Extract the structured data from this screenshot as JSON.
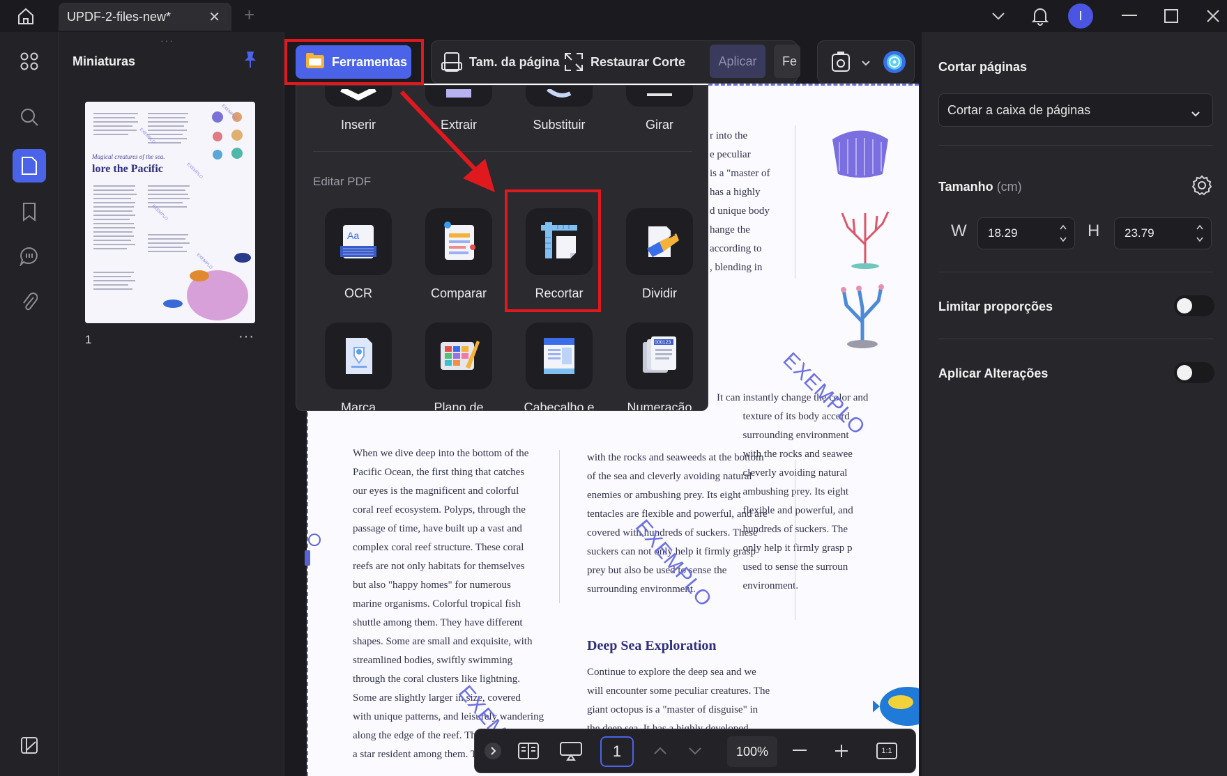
{
  "titlebar": {
    "tab_title": "UPDF-2-files-new*",
    "tab_close": "✕",
    "tab_add": "+",
    "avatar_initial": "I"
  },
  "thumbnails": {
    "title": "Miniaturas",
    "page_number": "1",
    "more": "···",
    "thumb_heading_small": "Magical creatures of the sea.",
    "thumb_heading": "lore the Pacific"
  },
  "toolbar": {
    "tools_label": "Ferramentas",
    "page_size_label": "Tam. da página",
    "restore_crop_label": "Restaurar Corte",
    "apply_label": "Aplicar",
    "truncated_label": "Fe"
  },
  "tools_panel": {
    "top_row": [
      "Inserir",
      "Extrair",
      "Substituir",
      "Girar"
    ],
    "section_label": "Editar PDF",
    "row1": [
      "OCR",
      "Comparar",
      "Recortar",
      "Dividir"
    ],
    "row2": [
      "Marca",
      "Plano de",
      "Cabeçalho e",
      "Numeração"
    ]
  },
  "document": {
    "col3_top": "r into the\ne peculiar\nis a \"master of\nhas a highly\nd unique body\nhange the\naccording to\n, blending in",
    "col3_mid": "It can instantly change the color and\n          texture of its body accord\n          surrounding environment\n          with the rocks and seawee\n          cleverly avoiding natural\n          ambushing prey. Its eight\n          flexible and powerful, and\n          hundreds of suckers. The\n          only help it firmly grasp p\n          used to sense the surroun\n          environment.",
    "col1": "When we dive deep into the bottom of the\nPacific Ocean, the first thing that catches\nour eyes is the magnificent and colorful\ncoral reef ecosystem. Polyps, through the\npassage of time, have built up a vast and\ncomplex coral reef structure. These coral\nreefs are not only habitats for themselves\nbut also \"happy homes\" for numerous\nmarine organisms. Colorful tropical fish\nshuttle among them. They have different\nshapes. Some are small and exquisite, with\nstreamlined bodies, swiftly swimming\nthrough the coral clusters like lightning.\nSome are slightly larger in size, covered\nwith unique patterns, and leisurely wandering\nalong the edge of the reef. Th\na star resident among them. T",
    "col2": "with the rocks and seaweeds at the bottom\nof the sea and cleverly avoiding natural\nenemies or ambushing prey. Its eight\ntentacles are flexible and powerful, and are\ncovered with hundreds of suckers. These\nsuckers can not only help it firmly grasp\nprey but also be used to sense the\nsurrounding environment.",
    "heading": "Deep Sea Exploration",
    "col2_bottom": "Continue to explore the deep sea and we\nwill encounter some peculiar creatures. The\ngiant octopus is a \"master of disguise\" in\nthe deep sea. It has a highly developed",
    "watermark": "EXEMPLO"
  },
  "bottombar": {
    "page": "1",
    "zoom": "100%",
    "fit": "1:1"
  },
  "right_panel": {
    "title": "Cortar páginas",
    "select_value": "Cortar a caixa de páginas",
    "size_label": "Tamanho",
    "size_unit": "(cm)",
    "w_label": "W",
    "w_value": "18.29",
    "h_label": "H",
    "h_value": "23.79",
    "lock_ratio_label": "Limitar proporções",
    "apply_changes_label": "Aplicar Alterações",
    "lock_ratio_on": false,
    "apply_changes_on": false
  },
  "colors": {
    "accent": "#4b63e8",
    "highlight_red": "#e0191f",
    "watermark": "#6c70e3"
  }
}
